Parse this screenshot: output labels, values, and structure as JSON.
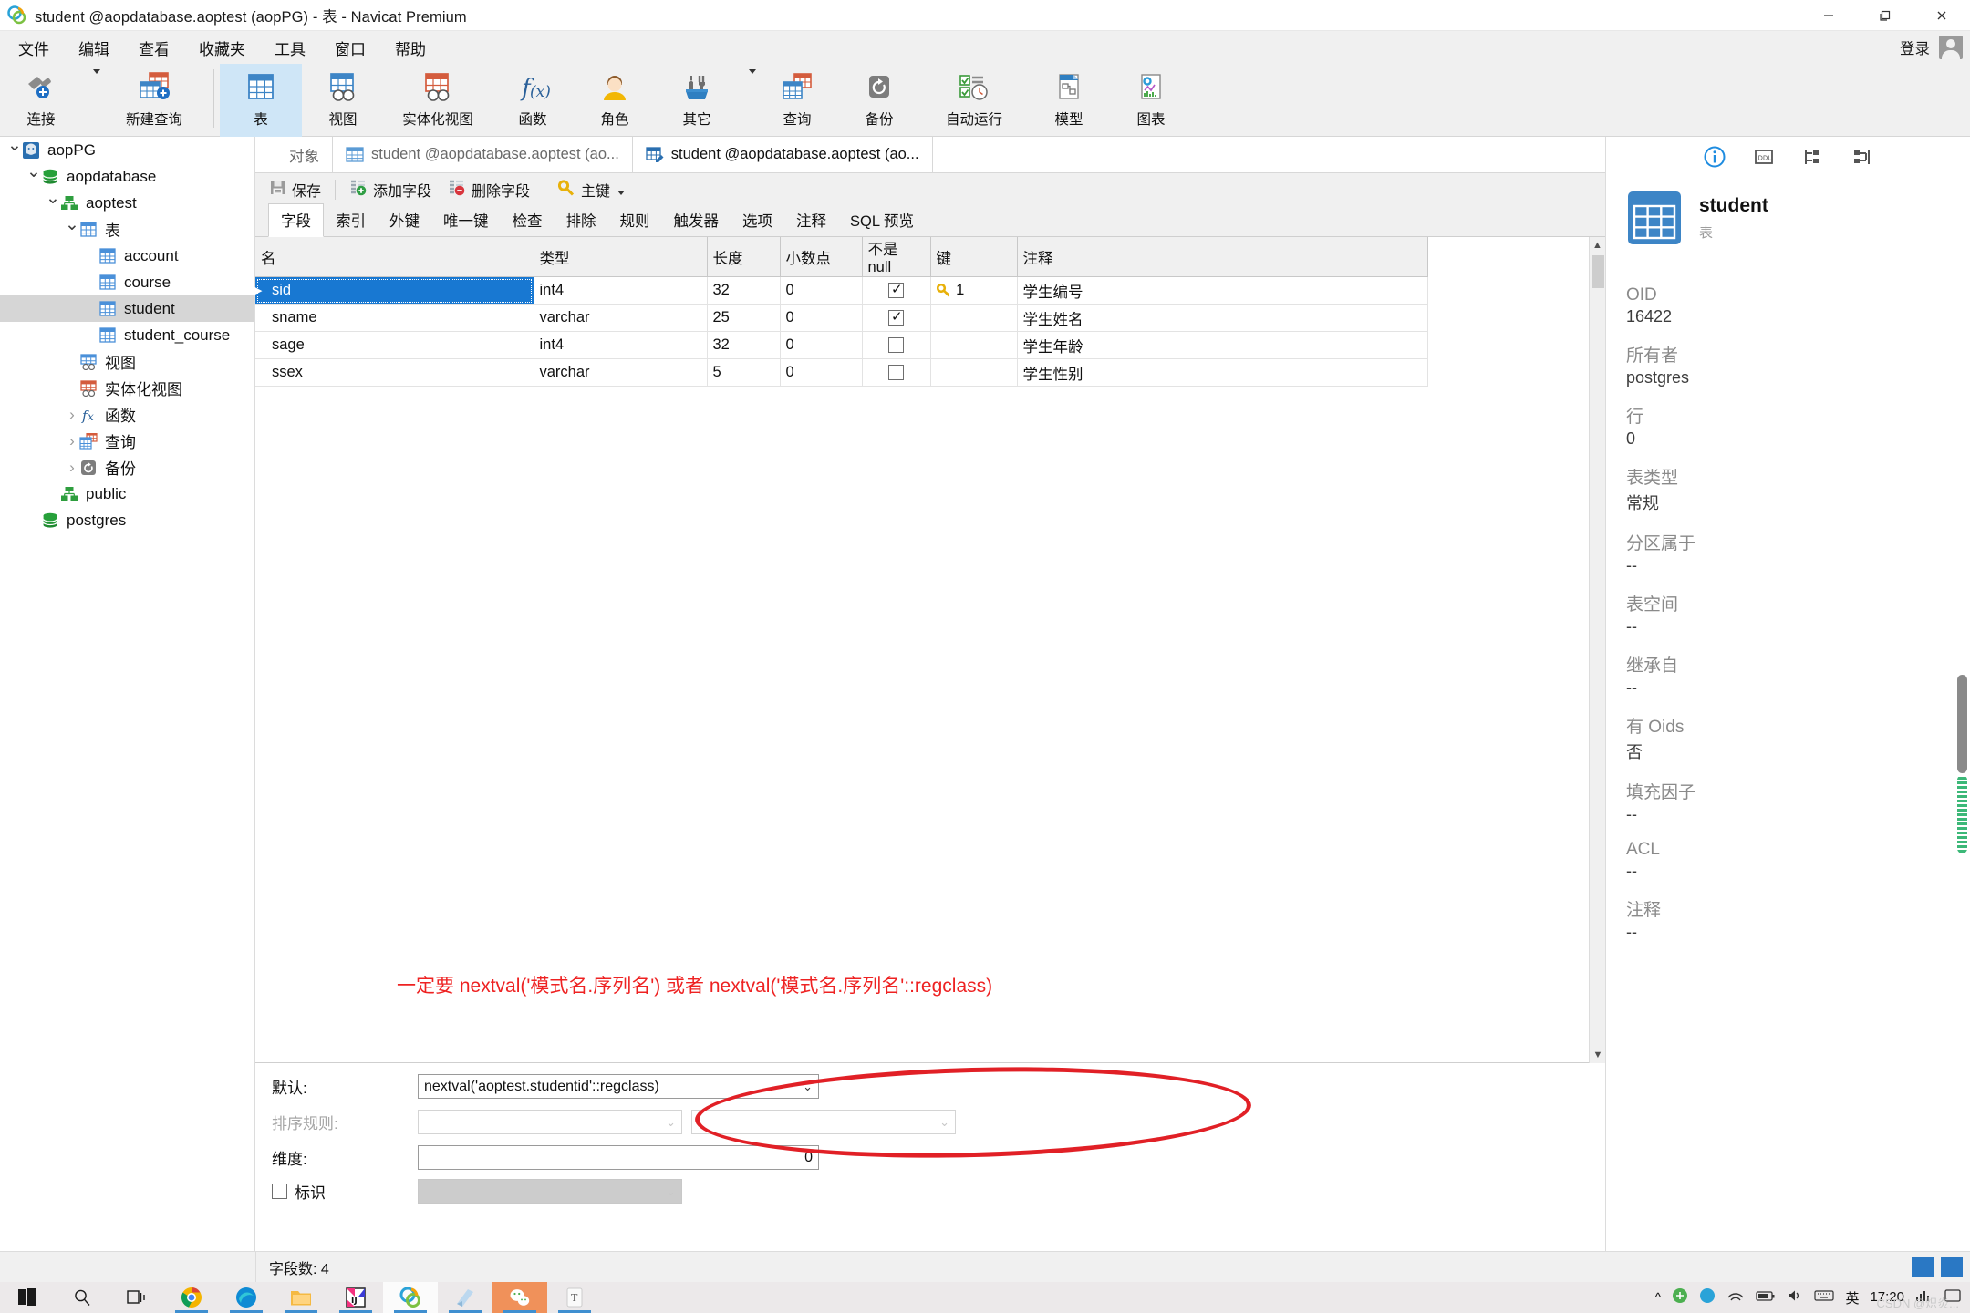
{
  "window": {
    "title": "student @aopdatabase.aoptest (aopPG) - 表 - Navicat Premium",
    "minimize": "—",
    "maximize": "❐",
    "close": "✕"
  },
  "menubar": {
    "items": [
      "文件",
      "编辑",
      "查看",
      "收藏夹",
      "工具",
      "窗口",
      "帮助"
    ],
    "login_label": "登录"
  },
  "ribbon": {
    "items": [
      {
        "label": "连接",
        "icon": "connection-icon",
        "has_caret": true
      },
      {
        "label": "新建查询",
        "icon": "new-query-icon",
        "has_caret": false
      },
      {
        "label": "表",
        "icon": "table-icon",
        "selected": true,
        "has_caret": false
      },
      {
        "label": "视图",
        "icon": "view-icon",
        "has_caret": false
      },
      {
        "label": "实体化视图",
        "icon": "materialized-view-icon",
        "has_caret": false
      },
      {
        "label": "函数",
        "icon": "function-icon",
        "has_caret": false
      },
      {
        "label": "角色",
        "icon": "role-icon",
        "has_caret": false
      },
      {
        "label": "其它",
        "icon": "others-icon",
        "has_caret": true
      },
      {
        "label": "查询",
        "icon": "query-icon",
        "has_caret": false
      },
      {
        "label": "备份",
        "icon": "backup-icon",
        "has_caret": false
      },
      {
        "label": "自动运行",
        "icon": "automation-icon",
        "has_caret": false
      },
      {
        "label": "模型",
        "icon": "model-icon",
        "has_caret": false
      },
      {
        "label": "图表",
        "icon": "chart-icon",
        "has_caret": false
      }
    ]
  },
  "sidebar": {
    "items": [
      {
        "label": "aopPG",
        "indent": 0,
        "chevron": "down",
        "icon": "postgres-server-icon"
      },
      {
        "label": "aopdatabase",
        "indent": 1,
        "chevron": "down",
        "icon": "database-icon"
      },
      {
        "label": "aoptest",
        "indent": 2,
        "chevron": "down",
        "icon": "schema-icon"
      },
      {
        "label": "表",
        "indent": 3,
        "chevron": "down",
        "icon": "table-folder-icon"
      },
      {
        "label": "account",
        "indent": 4,
        "chevron": "",
        "icon": "table-icon"
      },
      {
        "label": "course",
        "indent": 4,
        "chevron": "",
        "icon": "table-icon"
      },
      {
        "label": "student",
        "indent": 4,
        "chevron": "",
        "icon": "table-icon",
        "selected": true
      },
      {
        "label": "student_course",
        "indent": 4,
        "chevron": "",
        "icon": "table-icon"
      },
      {
        "label": "视图",
        "indent": 3,
        "chevron": "",
        "icon": "view-icon"
      },
      {
        "label": "实体化视图",
        "indent": 3,
        "chevron": "",
        "icon": "materialized-view-icon"
      },
      {
        "label": "函数",
        "indent": 3,
        "chevron": "right",
        "icon": "function-icon"
      },
      {
        "label": "查询",
        "indent": 3,
        "chevron": "right",
        "icon": "query-icon"
      },
      {
        "label": "备份",
        "indent": 3,
        "chevron": "right",
        "icon": "backup-icon"
      },
      {
        "label": "public",
        "indent": 2,
        "chevron": "",
        "icon": "schema-icon"
      },
      {
        "label": "postgres",
        "indent": 1,
        "chevron": "",
        "icon": "database-icon"
      }
    ]
  },
  "tabstrip": {
    "tabs": [
      {
        "label": "对象",
        "icon": "",
        "active": false
      },
      {
        "label": "student @aopdatabase.aoptest (ao...",
        "icon": "table-icon",
        "active": false
      },
      {
        "label": "student @aopdatabase.aoptest (ao...",
        "icon": "table-design-icon",
        "active": true
      }
    ]
  },
  "editor_toolbar": {
    "buttons": [
      {
        "label": "保存",
        "icon": "save-icon"
      },
      {
        "label": "添加字段",
        "icon": "add-field-icon"
      },
      {
        "label": "删除字段",
        "icon": "delete-field-icon"
      },
      {
        "label": "主键",
        "icon": "primary-key-icon",
        "caret": true
      }
    ]
  },
  "subtabs": {
    "items": [
      "字段",
      "索引",
      "外键",
      "唯一键",
      "检查",
      "排除",
      "规则",
      "触发器",
      "选项",
      "注释",
      "SQL 预览"
    ],
    "active_index": 0
  },
  "fields_grid": {
    "columns": [
      "名",
      "类型",
      "长度",
      "小数点",
      "不是 null",
      "键",
      "注释"
    ],
    "rows": [
      {
        "name": "sid",
        "type": "int4",
        "length": "32",
        "decimals": "0",
        "not_null": true,
        "key": "1",
        "comment": "学生编号",
        "selected": true
      },
      {
        "name": "sname",
        "type": "varchar",
        "length": "25",
        "decimals": "0",
        "not_null": true,
        "key": "",
        "comment": "学生姓名",
        "selected": false
      },
      {
        "name": "sage",
        "type": "int4",
        "length": "32",
        "decimals": "0",
        "not_null": false,
        "key": "",
        "comment": "学生年龄",
        "selected": false
      },
      {
        "name": "ssex",
        "type": "varchar",
        "length": "5",
        "decimals": "0",
        "not_null": false,
        "key": "",
        "comment": "学生性别",
        "selected": false
      }
    ]
  },
  "annotation": {
    "red_note": "一定要 nextval('模式名.序列名') 或者 nextval('模式名.序列名'::regclass)",
    "red_color": "#ee2222",
    "highlight_shape": "ellipse"
  },
  "properties": {
    "default_label": "默认:",
    "default_value": "nextval('aoptest.studentid'::regclass)",
    "collation_label": "排序规则:",
    "collation_value": "",
    "collation_value2": "",
    "dimension_label": "维度:",
    "dimension_value": "0",
    "identity_label": "标识",
    "identity_checked": false,
    "identity_value": ""
  },
  "info_panel": {
    "tabs": [
      "info-icon",
      "ddl-icon",
      "structure-icon",
      "relation-icon"
    ],
    "active_tab": 0,
    "object_name": "student",
    "object_type": "表",
    "properties": [
      {
        "key": "OID",
        "value": "16422"
      },
      {
        "key": "所有者",
        "value": "postgres"
      },
      {
        "key": "行",
        "value": "0"
      },
      {
        "key": "表类型",
        "value": "常规"
      },
      {
        "key": "分区属于",
        "value": "--"
      },
      {
        "key": "表空间",
        "value": "--"
      },
      {
        "key": "继承自",
        "value": "--"
      },
      {
        "key": "有 Oids",
        "value": "否"
      },
      {
        "key": "填充因子",
        "value": "--"
      },
      {
        "key": "ACL",
        "value": "--"
      },
      {
        "key": "注释",
        "value": "--"
      }
    ]
  },
  "statusbar": {
    "field_count": "字段数: 4"
  },
  "taskbar": {
    "items": [
      {
        "name": "start-button",
        "icon": "windows-logo"
      },
      {
        "name": "search-button",
        "icon": "search-icon"
      },
      {
        "name": "task-view-button",
        "icon": "task-view-icon"
      },
      {
        "name": "chrome",
        "icon": "chrome-icon",
        "running": true
      },
      {
        "name": "edge",
        "icon": "edge-icon",
        "running": true
      },
      {
        "name": "file-explorer",
        "icon": "folder-icon",
        "running": true
      },
      {
        "name": "idea",
        "icon": "intellij-icon",
        "running": true
      },
      {
        "name": "navicat",
        "icon": "navicat-icon",
        "running": true,
        "active": true
      },
      {
        "name": "notepad",
        "icon": "book-icon",
        "running": true
      },
      {
        "name": "wechat",
        "icon": "wechat-icon",
        "running": true,
        "highlighted": true
      },
      {
        "name": "typora",
        "icon": "typora-icon",
        "running": true
      }
    ],
    "tray": {
      "ime": "英",
      "time": "17:20",
      "show_hidden": "^"
    }
  },
  "watermark": "CSDN @炽炎..."
}
